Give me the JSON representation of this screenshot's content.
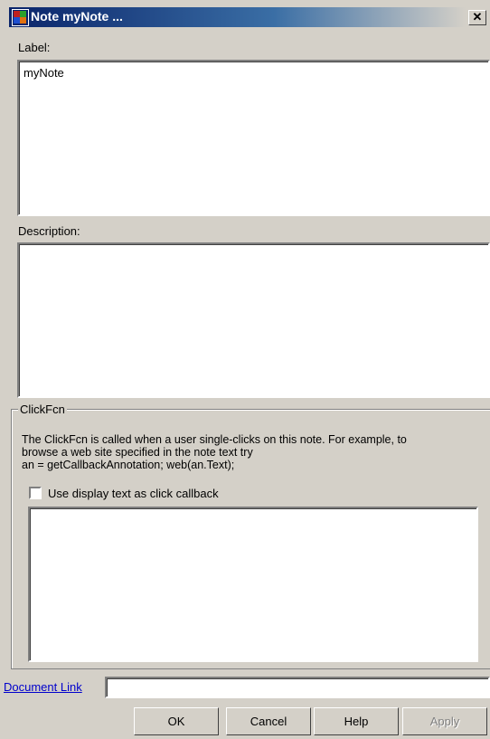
{
  "window": {
    "title": "Note myNote ...",
    "close_glyph": "✕"
  },
  "label_section": {
    "label": "Label:",
    "value": "myNote"
  },
  "description_section": {
    "label": "Description:",
    "value": ""
  },
  "clickfcn": {
    "group_title": "ClickFcn",
    "description_line1": "The ClickFcn is called when a user single-clicks on this note. For example, to",
    "description_line2": "browse a web site specified in the note text try",
    "description_line3": "an = getCallbackAnnotation; web(an.Text);",
    "checkbox_label": "Use display text as click callback",
    "checkbox_checked": false,
    "callback_value": ""
  },
  "document_link": {
    "label": "Document Link",
    "value": ""
  },
  "buttons": {
    "ok": "OK",
    "cancel": "Cancel",
    "help": "Help",
    "apply": "Apply"
  }
}
